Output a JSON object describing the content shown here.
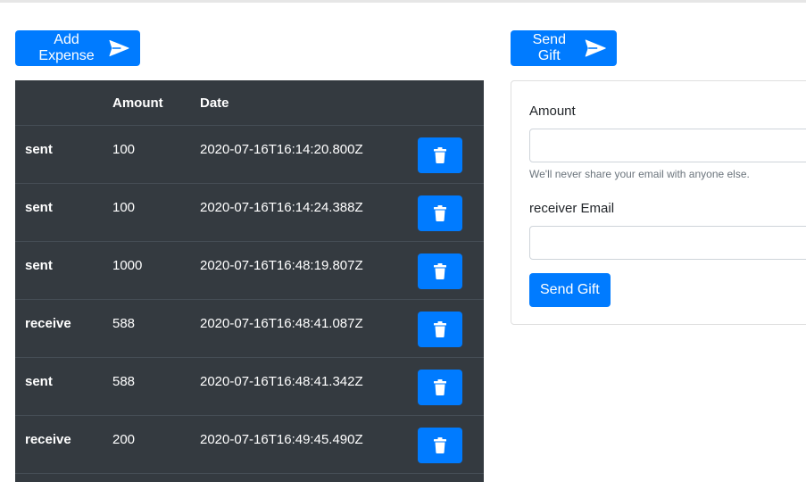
{
  "buttons": {
    "add_expense": "Add Expense",
    "send_gift_top": "Send Gift",
    "send_gift_submit": "Send Gift"
  },
  "table": {
    "headers": [
      "",
      "Amount",
      "Date",
      ""
    ],
    "rows": [
      {
        "type": "sent",
        "amount": "100",
        "date": "2020-07-16T16:14:20.800Z"
      },
      {
        "type": "sent",
        "amount": "100",
        "date": "2020-07-16T16:14:24.388Z"
      },
      {
        "type": "sent",
        "amount": "1000",
        "date": "2020-07-16T16:48:19.807Z"
      },
      {
        "type": "receive",
        "amount": "588",
        "date": "2020-07-16T16:48:41.087Z"
      },
      {
        "type": "sent",
        "amount": "588",
        "date": "2020-07-16T16:48:41.342Z"
      },
      {
        "type": "receive",
        "amount": "200",
        "date": "2020-07-16T16:49:45.490Z"
      }
    ]
  },
  "form": {
    "amount_label": "Amount",
    "amount_value": "",
    "help_text": "We'll never share your email with anyone else.",
    "email_label": "receiver Email",
    "email_value": ""
  },
  "icons": {
    "send": "paper-plane-icon",
    "delete": "trash-icon"
  },
  "colors": {
    "primary": "#007bff",
    "table_bg": "#343a40",
    "row_border": "#454d55"
  }
}
